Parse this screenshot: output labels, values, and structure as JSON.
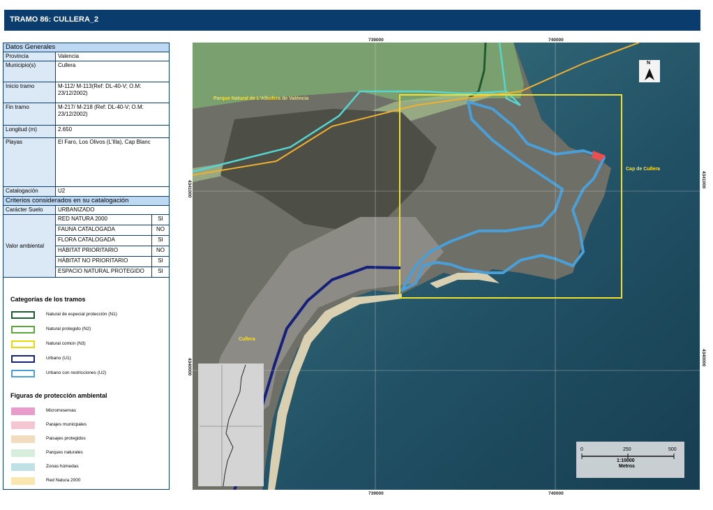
{
  "title": "TRAMO 86: CULLERA_2",
  "general": {
    "header": "Datos Generales",
    "rows": [
      {
        "label": "Provincia",
        "value": "Valencia"
      },
      {
        "label": "Municipio(s)",
        "value": "Cullera"
      },
      {
        "label": "Inicio tramo",
        "value": "M-112/ M-113(Ref: DL-40-V; O.M: 23/12/2002)"
      },
      {
        "label": "Fin tramo",
        "value": "M-217/ M-218 (Ref: DL-40-V; O.M: 23/12/2002)"
      },
      {
        "label": "Longitud (m)",
        "value": "2.650"
      },
      {
        "label": "Playas",
        "value": "El Faro, Los Olivos (L'Illa), Cap Blanc"
      },
      {
        "label": "Catalogación",
        "value": "U2"
      }
    ]
  },
  "criteria": {
    "header": "Criterios considerados en su catalogación",
    "suelo_label": "Carácter Suelo",
    "suelo_value": "URBANIZADO",
    "valor_label": "Valor ambiental",
    "items": [
      {
        "name": "RED NATURA 2000",
        "value": "SI"
      },
      {
        "name": "FAUNA CATALOGADA",
        "value": "NO"
      },
      {
        "name": "FLORA CATALOGADA",
        "value": "SI"
      },
      {
        "name": "HÁBITAT PRIORITARIO",
        "value": "NO"
      },
      {
        "name": "HÁBITAT NO PRIORITARIO",
        "value": "SI"
      },
      {
        "name": "ESPACIO NATURAL PROTEGIDO",
        "value": "SI"
      }
    ]
  },
  "legend_categories": {
    "title": "Categorías de los tramos",
    "items": [
      {
        "label": "Natural de especial protección (N1)",
        "color": "#1f5a2e"
      },
      {
        "label": "Natural protegido (N2)",
        "color": "#5aa83a"
      },
      {
        "label": "Natural común (N3)",
        "color": "#e6d800"
      },
      {
        "label": "Urbano (U1)",
        "color": "#14207a"
      },
      {
        "label": "Urbano con restricciones (U2)",
        "color": "#4a9fd8"
      }
    ]
  },
  "legend_protection": {
    "title": "Figuras de protección ambiental",
    "items": [
      {
        "label": "Microrreservas",
        "color": "#e79ccb"
      },
      {
        "label": "Parajes municipales",
        "color": "#f4c6d2"
      },
      {
        "label": "Paisajes protegidos",
        "color": "#f2dcbf"
      },
      {
        "label": "Parques naturales",
        "color": "#d8eedd"
      },
      {
        "label": "Zonas húmedas",
        "color": "#bfe1e6"
      },
      {
        "label": "Red Natura 2000",
        "color": "#fae6b0"
      }
    ]
  },
  "map": {
    "coords_top": [
      "739000",
      "740000"
    ],
    "coords_bottom": [
      "739000",
      "740000"
    ],
    "coords_left": [
      "4341000",
      "4340000"
    ],
    "coords_right": [
      "4341000",
      "4340000"
    ],
    "labels": {
      "park": "Parque Natural de L'Albufera de València",
      "cape": "Cap de Cullera",
      "town": "Cullera"
    },
    "north": "N",
    "scale": {
      "ticks": [
        "0",
        "250",
        "500"
      ],
      "ratio": "1:10000",
      "unit": "Metros"
    }
  }
}
